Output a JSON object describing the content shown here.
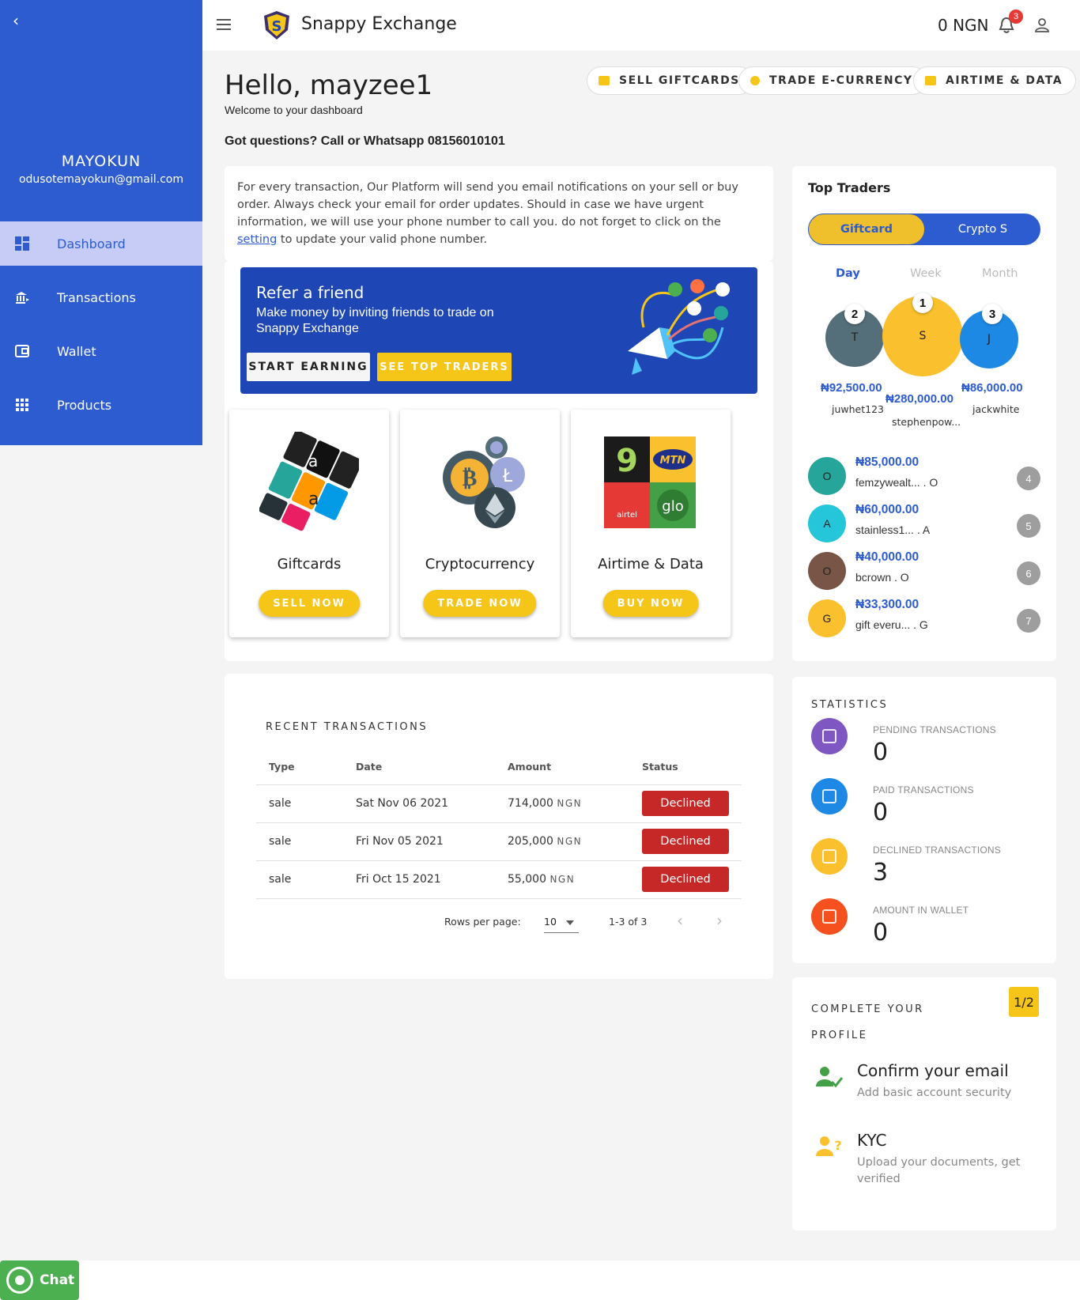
{
  "sidebar": {
    "user_name": "MAYOKUN",
    "user_email": "odusotemayokun@gmail.com",
    "items": [
      {
        "label": "Dashboard",
        "icon": "dashboard-icon",
        "active": true
      },
      {
        "label": "Transactions",
        "icon": "transactions-icon",
        "active": false
      },
      {
        "label": "Wallet",
        "icon": "wallet-icon",
        "active": false
      },
      {
        "label": "Products",
        "icon": "grid-icon",
        "active": false
      }
    ]
  },
  "header": {
    "brand": "Snappy Exchange",
    "balance": "0 NGN",
    "notification_count": "3"
  },
  "greeting": {
    "title": "Hello, mayzee1",
    "subtitle": "Welcome to your dashboard",
    "questions": "Got questions? Call or Whatsapp 08156010101"
  },
  "quick_actions": [
    {
      "label": "SELL GIFTCARDS",
      "icon": "giftcard-icon"
    },
    {
      "label": "TRADE E-CURRENCY",
      "icon": "bitcoin-icon"
    },
    {
      "label": "AIRTIME & DATA",
      "icon": "sim-icon"
    }
  ],
  "notice": {
    "text_before": "For every transaction, Our Platform will send you email notifications on your sell or buy order. Always check your email for order updates. Should in case we have urgent information, we will use your phone number to call you. do not forget to click on the ",
    "link": "setting",
    "text_after": " to update your valid phone number."
  },
  "refer": {
    "title": "Refer a friend",
    "subtitle": "Make money by inviting friends to trade on Snappy Exchange",
    "start_label": "START EARNING",
    "traders_label": "SEE TOP TRADERS"
  },
  "products": [
    {
      "title": "Giftcards",
      "button": "SELL NOW"
    },
    {
      "title": "Cryptocurrency",
      "button": "TRADE NOW"
    },
    {
      "title": "Airtime & Data",
      "button": "BUY NOW"
    }
  ],
  "transactions": {
    "heading": "RECENT TRANSACTIONS",
    "columns": [
      "Type",
      "Date",
      "Amount",
      "Status"
    ],
    "rows": [
      {
        "type": "sale",
        "date": "Sat Nov 06 2021",
        "amount": "714,000",
        "currency": "NGN",
        "status": "Declined"
      },
      {
        "type": "sale",
        "date": "Fri Nov 05 2021",
        "amount": "205,000",
        "currency": "NGN",
        "status": "Declined"
      },
      {
        "type": "sale",
        "date": "Fri Oct 15 2021",
        "amount": "55,000",
        "currency": "NGN",
        "status": "Declined"
      }
    ],
    "rows_per_page_label": "Rows per page:",
    "rows_per_page": "10",
    "range": "1-3 of 3"
  },
  "top_traders": {
    "heading": "Top Traders",
    "tabs": [
      "Giftcard",
      "Crypto S"
    ],
    "periods": [
      "Day",
      "Week",
      "Month"
    ],
    "podium": [
      {
        "rank": "2",
        "initial": "T",
        "amount": "₦92,500.00",
        "name": "juwhet123",
        "color": "#546e7a"
      },
      {
        "rank": "1",
        "initial": "S",
        "amount": "₦280,000.00",
        "name": "stephenpow...",
        "color": "#fbc02d"
      },
      {
        "rank": "3",
        "initial": "J",
        "amount": "₦86,000.00",
        "name": "jackwhite",
        "color": "#1e88e5"
      }
    ],
    "list": [
      {
        "initial": "O",
        "amount": "₦85,000.00",
        "name": "femzywealt... . O",
        "rank": "4",
        "color": "#26a69a"
      },
      {
        "initial": "A",
        "amount": "₦60,000.00",
        "name": "stainless1... . A",
        "rank": "5",
        "color": "#26c6da"
      },
      {
        "initial": "O",
        "amount": "₦40,000.00",
        "name": "bcrown . O",
        "rank": "6",
        "color": "#795548"
      },
      {
        "initial": "G",
        "amount": "₦33,300.00",
        "name": "gift everu... . G",
        "rank": "7",
        "color": "#fbc02d"
      }
    ]
  },
  "statistics": {
    "heading": "STATISTICS",
    "items": [
      {
        "label": "PENDING TRANSACTIONS",
        "value": "0",
        "color": "#7e57c2",
        "icon": "hourglass-icon"
      },
      {
        "label": "PAID TRANSACTIONS",
        "value": "0",
        "color": "#1e88e5",
        "icon": "receipt-icon"
      },
      {
        "label": "DECLINED TRANSACTIONS",
        "value": "3",
        "color": "#fbc02d",
        "icon": "declined-card-icon"
      },
      {
        "label": "AMOUNT IN WALLET",
        "value": "0",
        "color": "#f4511e",
        "icon": "wallet-icon"
      }
    ]
  },
  "profile": {
    "heading": "COMPLETE YOUR PROFILE",
    "progress": "1/2",
    "items": [
      {
        "title": "Confirm your email",
        "subtitle": "Add basic account security",
        "icon": "user-check-icon"
      },
      {
        "title": "KYC",
        "subtitle": "Upload your documents, get verified",
        "icon": "user-question-icon"
      }
    ]
  },
  "chat": {
    "label": "Chat"
  }
}
